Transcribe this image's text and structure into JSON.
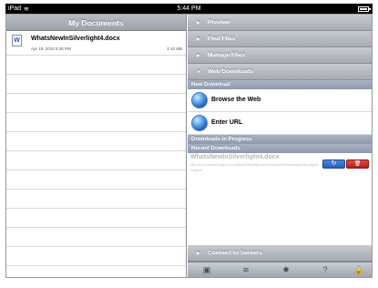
{
  "status": {
    "carrier": "iPad",
    "time": "5:44 PM",
    "battery": ""
  },
  "left": {
    "title": "My Documents",
    "documents": [
      {
        "name": "WhatsNewInSilverlight4.docx",
        "date": "Apr 19, 2010 5:26 PM",
        "size": "2.10 MB"
      }
    ],
    "empty_rows": 11
  },
  "right": {
    "sections": [
      "Preview",
      "Find Files",
      "Manage Files",
      "Web Downloads"
    ],
    "new_download_header": "New Download",
    "actions": [
      "Browse the Web",
      "Enter URL"
    ],
    "in_progress_header": "Downloads in Progress",
    "recent_header": "Recent Downloads",
    "recent": {
      "name": "WhatsNewInSilverlight4.docx",
      "url": "http://ecn.channel9.msdn.com/o9/learn/SilverlightLabs/Downloads/WhatsNewInSilverlight4.docx",
      "status": "Finished",
      "retry_icon": "↻",
      "delete_icon": "🗑"
    },
    "bottom_section": "Connect to Servers",
    "toolbar_icons": [
      "camera-icon",
      "wifi-icon",
      "gear-icon",
      "help-icon",
      "lock-icon"
    ]
  }
}
